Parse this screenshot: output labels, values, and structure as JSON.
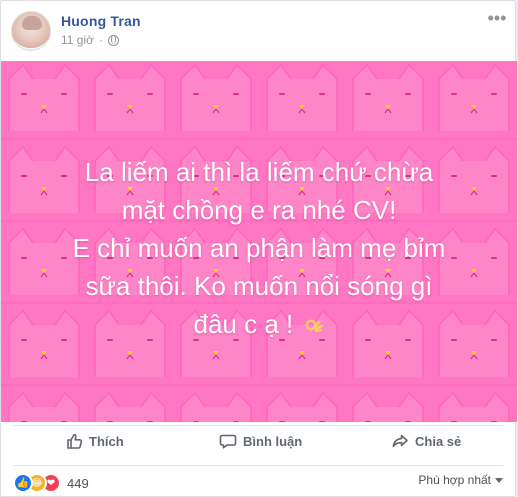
{
  "post": {
    "author": "Huong Tran",
    "time": "11 giờ",
    "separator": "·",
    "more_glyph": "•••",
    "media_text": {
      "lines": [
        "La liếm ai thì la liếm chứ chừa",
        "mặt chồng e ra nhé CV!",
        "E chỉ muốn an phận làm mẹ bỉm",
        "sữa thôi. Ko muốn nổi sóng gì",
        "đâu c ạ !"
      ]
    }
  },
  "actions": {
    "like": "Thích",
    "comment": "Bình luận",
    "share": "Chia sẻ"
  },
  "footer": {
    "reaction_count": "449",
    "sort_label": "Phù hợp nhất"
  },
  "theme": {
    "brand_link": "#365899",
    "media_bg": "#ff6fbf",
    "text_secondary": "#90949c"
  },
  "icons": {
    "privacy": "globe-icon",
    "more": "more-options-icon",
    "like": "like-icon",
    "comment": "comment-icon",
    "share": "share-icon",
    "ok": "ok-hand-emoji"
  }
}
